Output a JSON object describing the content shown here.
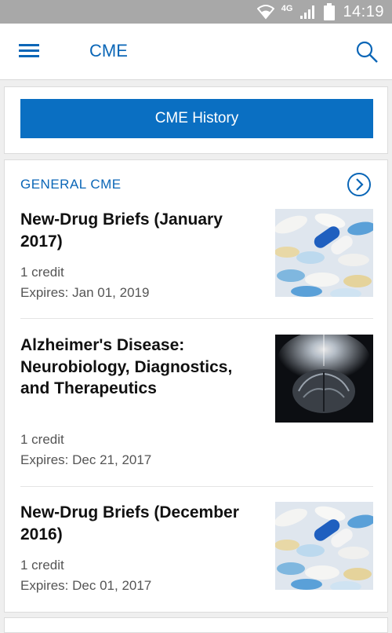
{
  "status_bar": {
    "network": "4G",
    "time": "14:19"
  },
  "app_bar": {
    "title": "CME"
  },
  "history_button": {
    "label": "CME History"
  },
  "section": {
    "title": "GENERAL CME",
    "items": [
      {
        "title": "New-Drug Briefs (January 2017)",
        "credit": "1 credit",
        "expires": "Expires: Jan 01, 2019",
        "image": "pills-image"
      },
      {
        "title": "Alzheimer's Disease: Neurobiology, Diagnostics, and Therapeutics",
        "credit": "1 credit",
        "expires": "Expires: Dec 21, 2017",
        "image": "brain-image"
      },
      {
        "title": "New-Drug Briefs (December 2016)",
        "credit": "1 credit",
        "expires": "Expires: Dec 01, 2017",
        "image": "pills-image"
      }
    ]
  },
  "colors": {
    "accent": "#0a66b7",
    "button": "#0a6fc2",
    "status_bar": "#a8a8a8"
  }
}
